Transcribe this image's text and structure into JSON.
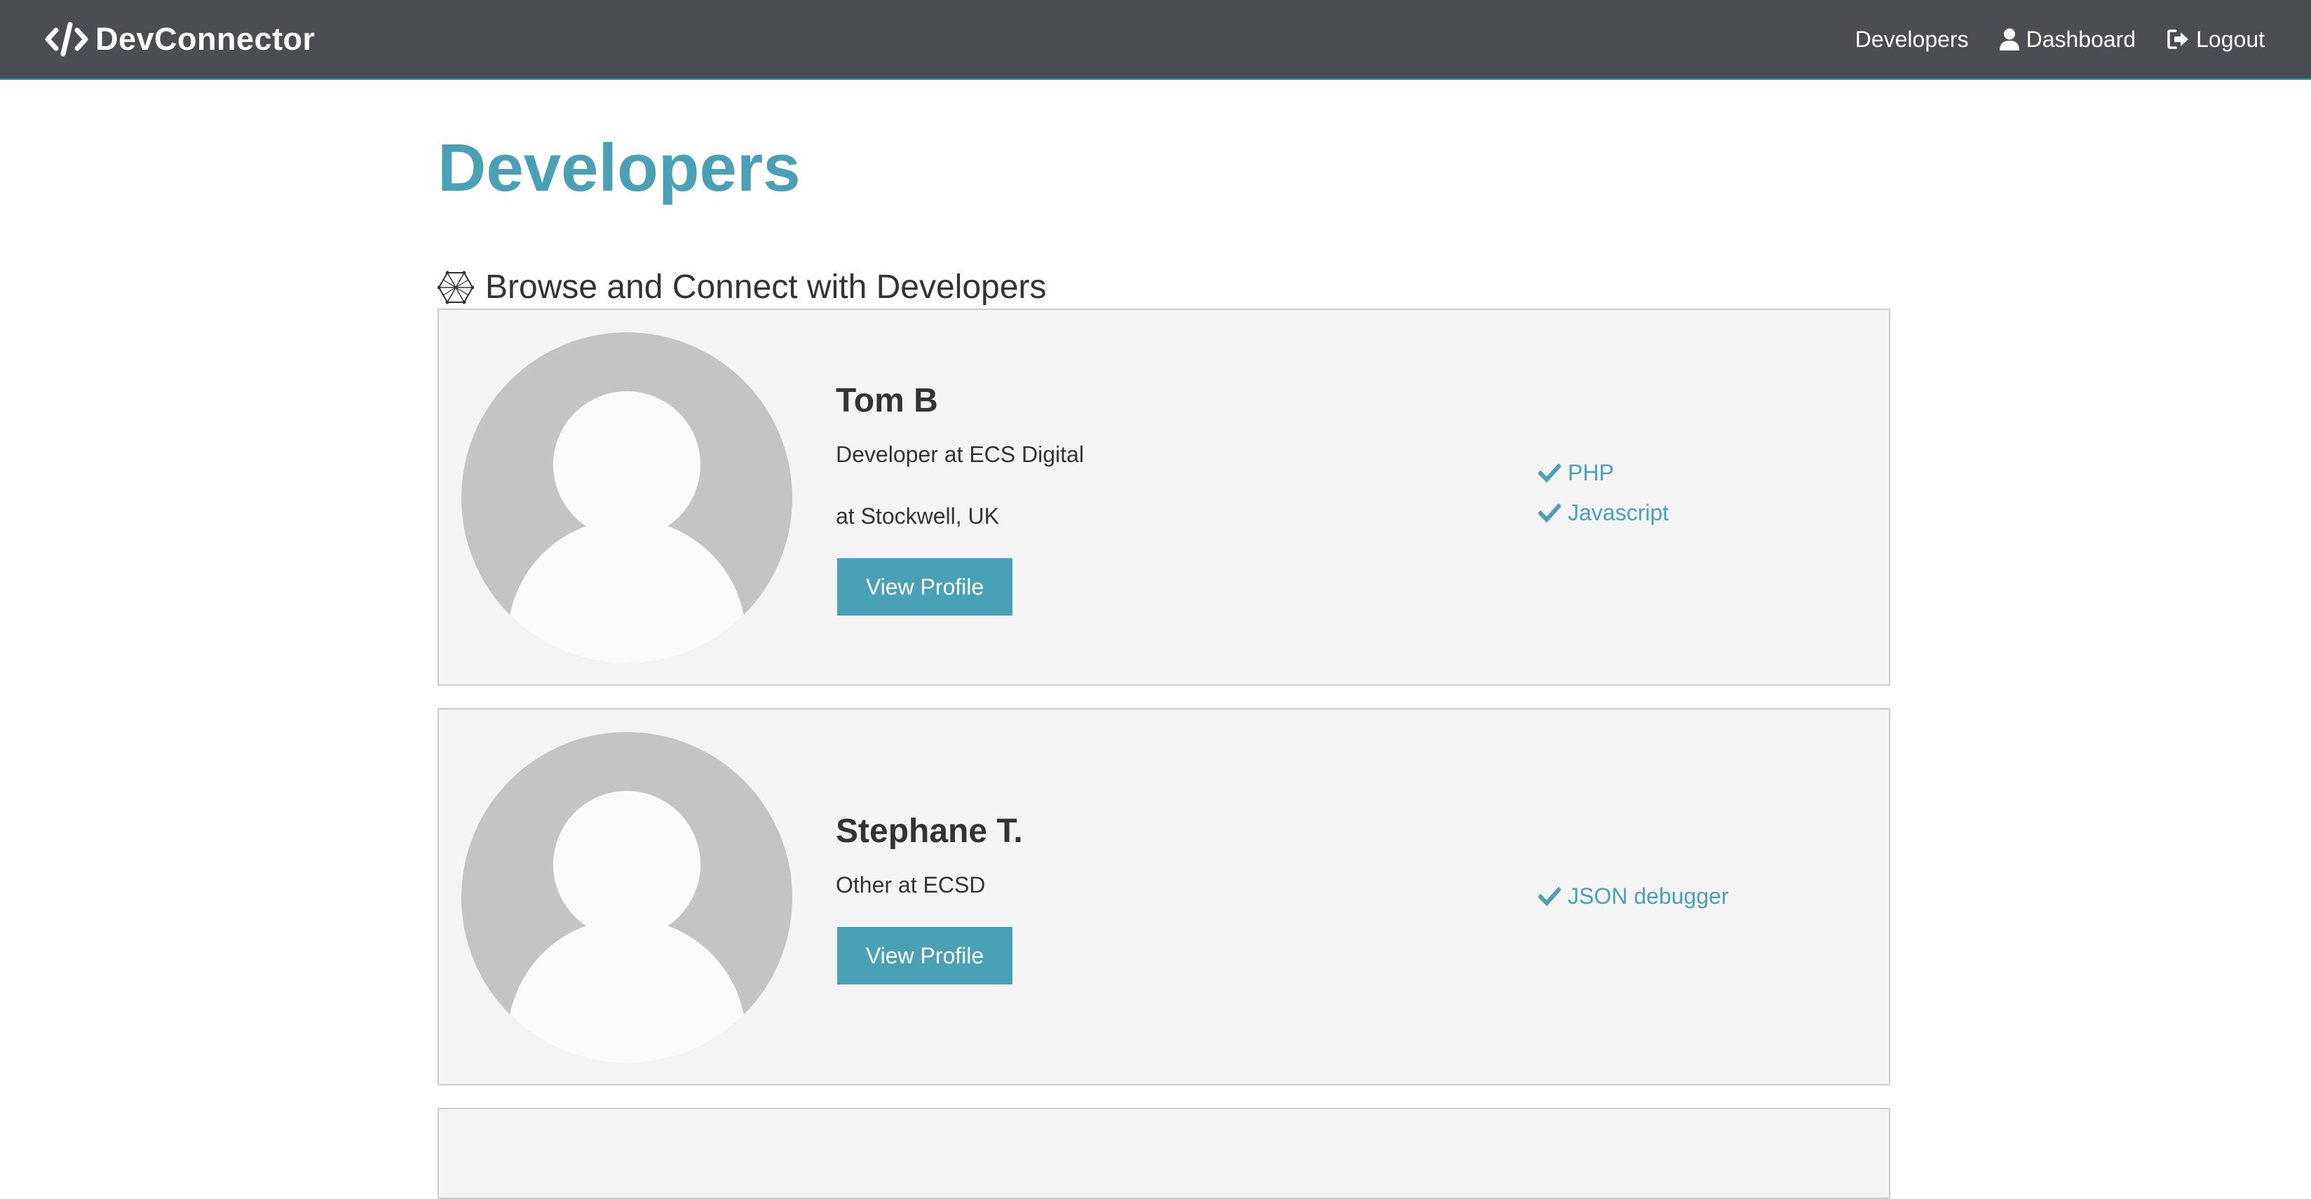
{
  "navbar": {
    "brand": "DevConnector",
    "links": [
      {
        "label": "Developers",
        "icon": ""
      },
      {
        "label": "Dashboard",
        "icon": "user-icon"
      },
      {
        "label": "Logout",
        "icon": "sign-out-icon"
      }
    ]
  },
  "page": {
    "title": "Developers",
    "lead": "Browse and Connect with Developers",
    "lead_icon": "connectdevelop-icon"
  },
  "profiles": [
    {
      "name": "Tom B",
      "status": "Developer at ECS Digital",
      "location": "at Stockwell, UK",
      "button": "View Profile",
      "skills": [
        "PHP",
        "Javascript"
      ]
    },
    {
      "name": "Stephane T.",
      "status": "Other at ECSD",
      "button": "View Profile",
      "skills": [
        "JSON debugger"
      ]
    }
  ],
  "colors": {
    "navbar": "#4a4d52",
    "primary": "#4aa0b5",
    "card_bg": "#f4f4f4",
    "avatar": "#c4c4c4"
  }
}
